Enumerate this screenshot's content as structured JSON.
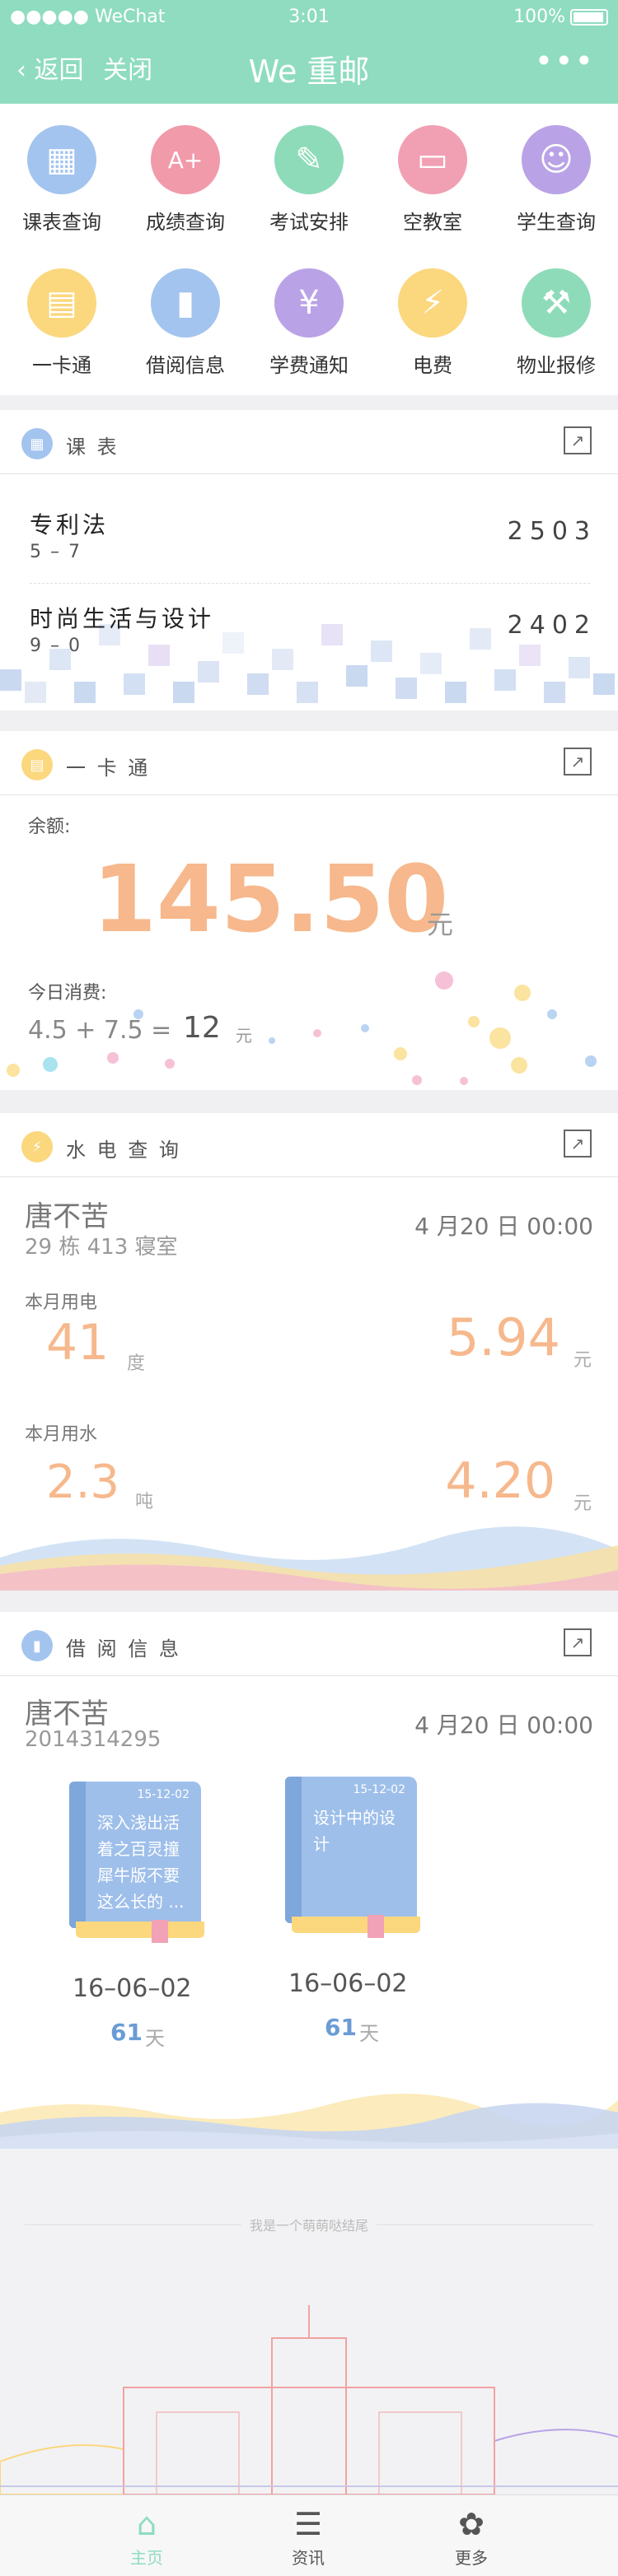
{
  "status": {
    "carrier": "●●●●● WeChat",
    "time": "3:01",
    "battery": "100%"
  },
  "nav": {
    "back": "返回",
    "close": "关闭",
    "title": "We 重邮",
    "more": "•••"
  },
  "grid": [
    {
      "label": "课表查询",
      "icon": "calendar-grid-icon",
      "color": "#a3c4ee",
      "glyph": "▦"
    },
    {
      "label": "成绩查询",
      "icon": "grade-doc-icon",
      "color": "#f09aaa",
      "glyph": "A+"
    },
    {
      "label": "考试安排",
      "icon": "pencil-icon",
      "color": "#8edbb9",
      "glyph": "✎"
    },
    {
      "label": "空教室",
      "icon": "board-icon",
      "color": "#f1a0b4",
      "glyph": "▭"
    },
    {
      "label": "学生查询",
      "icon": "student-icon",
      "color": "#b9a3e6",
      "glyph": "☺"
    },
    {
      "label": "一卡通",
      "icon": "card-icon",
      "color": "#fbd77e",
      "glyph": "▤"
    },
    {
      "label": "借阅信息",
      "icon": "book-icon",
      "color": "#a3c4ee",
      "glyph": "▮"
    },
    {
      "label": "学费通知",
      "icon": "yen-icon",
      "color": "#b9a3e6",
      "glyph": "¥"
    },
    {
      "label": "电费",
      "icon": "bolt-icon",
      "color": "#fbd77e",
      "glyph": "⚡"
    },
    {
      "label": "物业报修",
      "icon": "hammer-icon",
      "color": "#8edbb9",
      "glyph": "⚒"
    }
  ],
  "schedule": {
    "title": "课 表",
    "rows": [
      {
        "course": "专利法",
        "time": "5 – 7",
        "room": "2503"
      },
      {
        "course": "时尚生活与设计",
        "time": "9 – 0",
        "room": "2402"
      }
    ]
  },
  "card": {
    "title": "一 卡 通",
    "balance_label": "余额:",
    "balance": "145.50",
    "unit": "元",
    "today_label": "今日消费:",
    "today_expr": "4.5 + 7.5  =",
    "today_total": "12",
    "today_unit": "元"
  },
  "utility": {
    "title": "水 电 查 询",
    "name": "唐不苦",
    "dorm": "29 栋 413 寝室",
    "date": "4 月20 日  00:00",
    "elec_label": "本月用电",
    "elec_usage": "41",
    "elec_unit": "度",
    "elec_cost": "5.94",
    "elec_cost_unit": "元",
    "water_label": "本月用水",
    "water_usage": "2.3",
    "water_unit": "吨",
    "water_cost": "4.20",
    "water_cost_unit": "元"
  },
  "borrow": {
    "title": "借 阅 信 息",
    "name": "唐不苦",
    "id": "2014314295",
    "date": "4 月20 日  00:00",
    "books": [
      {
        "stamp": "15-12-02",
        "title": "深入浅出活着之百灵撞犀牛版不要这么长的 ...",
        "due": "16–06–02",
        "days": "61",
        "days_unit": "天"
      },
      {
        "stamp": "15-12-02",
        "title": "设计中的设计",
        "due": "16–06–02",
        "days": "61",
        "days_unit": "天"
      }
    ]
  },
  "footer": {
    "note": "我是一个萌萌哒结尾"
  },
  "tabs": [
    {
      "label": "主页",
      "icon": "home-icon",
      "glyph": "⌂",
      "active": true
    },
    {
      "label": "资讯",
      "icon": "news-icon",
      "glyph": "☰",
      "active": false
    },
    {
      "label": "更多",
      "icon": "more-flower-icon",
      "glyph": "✿",
      "active": false
    }
  ],
  "colors": {
    "header": "#8fdcc0",
    "accent": "#f6b88c",
    "link": "#6a9bd6"
  }
}
